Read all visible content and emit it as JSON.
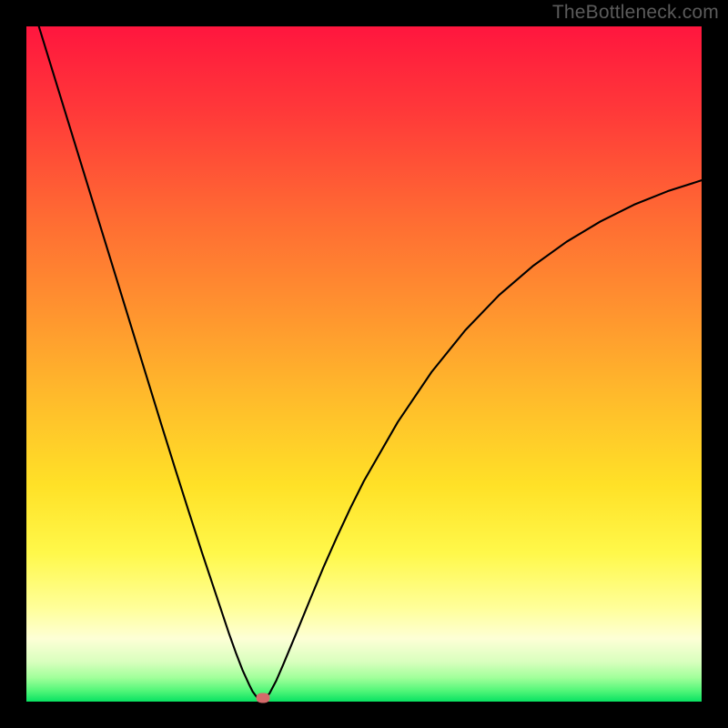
{
  "watermark": "TheBottleneck.com",
  "colors": {
    "gradient_stops": [
      {
        "offset": 0,
        "color": "#ff163e"
      },
      {
        "offset": 0.13,
        "color": "#ff3a39"
      },
      {
        "offset": 0.28,
        "color": "#ff6a33"
      },
      {
        "offset": 0.42,
        "color": "#ff932f"
      },
      {
        "offset": 0.55,
        "color": "#ffbb2b"
      },
      {
        "offset": 0.68,
        "color": "#ffe127"
      },
      {
        "offset": 0.78,
        "color": "#fff84a"
      },
      {
        "offset": 0.862,
        "color": "#ffff9a"
      },
      {
        "offset": 0.907,
        "color": "#fdffd6"
      },
      {
        "offset": 0.941,
        "color": "#d9ffbe"
      },
      {
        "offset": 0.965,
        "color": "#a0ff9a"
      },
      {
        "offset": 0.983,
        "color": "#56f77a"
      },
      {
        "offset": 1.0,
        "color": "#09e262"
      }
    ],
    "curve": "#000000",
    "frame": "#000000",
    "marker": "#d46a6a"
  },
  "chart_data": {
    "type": "line",
    "title": "",
    "xlabel": "",
    "ylabel": "",
    "xlim": [
      0,
      100
    ],
    "ylim": [
      0,
      100
    ],
    "grid": false,
    "legend": false,
    "marker": {
      "x": 35.0,
      "y": 0.5
    },
    "series": [
      {
        "name": "curve",
        "x": [
          0,
          2,
          4,
          6,
          8,
          10,
          12,
          14,
          16,
          18,
          20,
          22,
          24,
          26,
          28,
          30,
          31,
          32,
          33,
          33.5,
          34.2,
          35.3,
          36,
          37,
          38,
          40,
          42,
          44,
          46,
          48,
          50,
          55,
          60,
          65,
          70,
          75,
          80,
          85,
          90,
          95,
          100
        ],
        "y": [
          106,
          99.5,
          93,
          86.5,
          80,
          73.5,
          67,
          60.5,
          54,
          47.5,
          41,
          34.6,
          28.3,
          22.1,
          16.1,
          10.1,
          7.3,
          4.7,
          2.5,
          1.5,
          0.55,
          0.55,
          1.2,
          3.1,
          5.4,
          10.2,
          15.1,
          19.9,
          24.4,
          28.7,
          32.7,
          41.4,
          48.8,
          55.0,
          60.2,
          64.5,
          68.1,
          71.1,
          73.6,
          75.6,
          77.2
        ]
      }
    ]
  }
}
